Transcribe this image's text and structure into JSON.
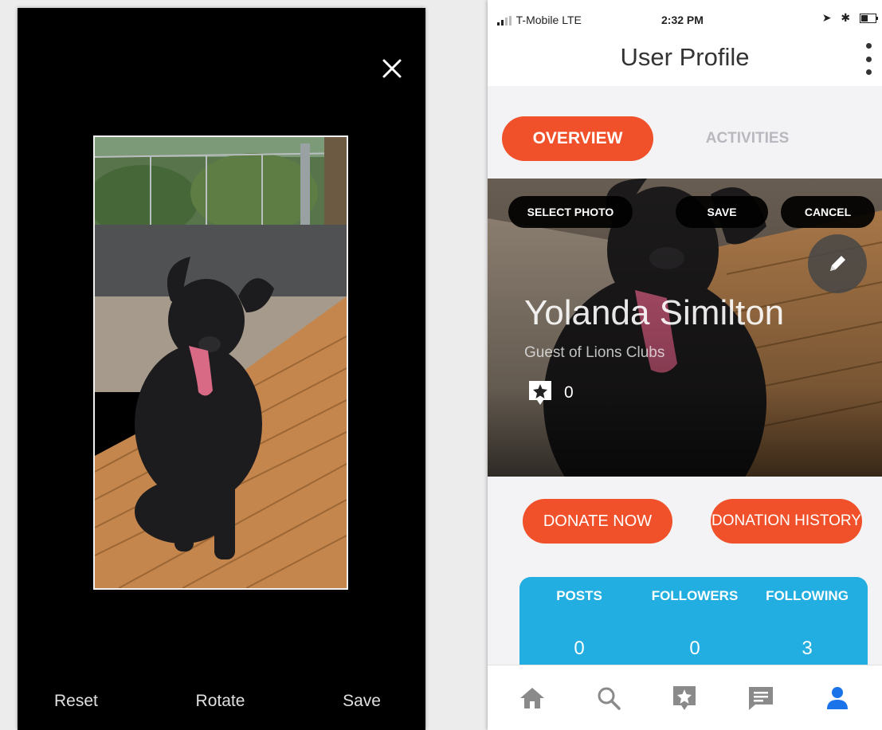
{
  "cropper": {
    "close_icon": "close-icon",
    "reset_label": "Reset",
    "rotate_label": "Rotate",
    "save_label": "Save"
  },
  "profile": {
    "status": {
      "carrier": "T-Mobile  LTE",
      "time": "2:32 PM"
    },
    "header": {
      "title": "User Profile",
      "menu_icon": "kebab-menu-icon"
    },
    "tabs": [
      {
        "label": "OVERVIEW",
        "active": true
      },
      {
        "label": "ACTIVITIES",
        "active": false
      }
    ],
    "cover": {
      "select_photo_label": "SELECT PHOTO",
      "save_label": "SAVE",
      "cancel_label": "CANCEL",
      "name": "Yolanda Similton",
      "subtitle": "Guest of Lions Clubs",
      "star_count": "0"
    },
    "actions": {
      "donate_label": "DONATE NOW",
      "history_label": "DONATION HISTORY"
    },
    "stats": [
      {
        "label": "POSTS",
        "value": "0"
      },
      {
        "label": "FOLLOWERS",
        "value": "0"
      },
      {
        "label": "FOLLOWING",
        "value": "3"
      }
    ],
    "tabbar": [
      "home-icon",
      "search-icon",
      "star-badge-icon",
      "chat-icon",
      "user-icon"
    ]
  },
  "colors": {
    "accent_orange": "#f0512a",
    "stats_blue": "#22aee0",
    "tabbar_active": "#1a73e8"
  }
}
